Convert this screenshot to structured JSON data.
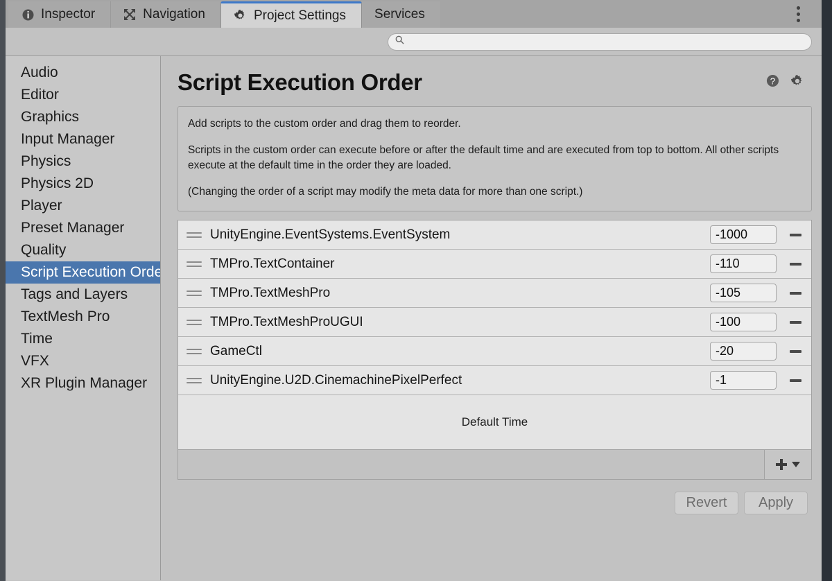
{
  "window": {
    "tabs": [
      {
        "label": "Inspector",
        "icon": "info-icon",
        "active": false
      },
      {
        "label": "Navigation",
        "icon": "move-arrows-icon",
        "active": false
      },
      {
        "label": "Project Settings",
        "icon": "gear-icon",
        "active": true
      },
      {
        "label": "Services",
        "icon": "none",
        "active": false
      }
    ],
    "menu_icon": "kebab-menu-icon",
    "accent_color": "#3d78c8"
  },
  "search": {
    "value": "",
    "placeholder": "",
    "icon": "search-icon"
  },
  "sidebar": {
    "items": [
      {
        "label": "Audio",
        "selected": false
      },
      {
        "label": "Editor",
        "selected": false
      },
      {
        "label": "Graphics",
        "selected": false
      },
      {
        "label": "Input Manager",
        "selected": false
      },
      {
        "label": "Physics",
        "selected": false
      },
      {
        "label": "Physics 2D",
        "selected": false
      },
      {
        "label": "Player",
        "selected": false
      },
      {
        "label": "Preset Manager",
        "selected": false
      },
      {
        "label": "Quality",
        "selected": false
      },
      {
        "label": "Script Execution Order",
        "selected": true
      },
      {
        "label": "Tags and Layers",
        "selected": false
      },
      {
        "label": "TextMesh Pro",
        "selected": false
      },
      {
        "label": "Time",
        "selected": false
      },
      {
        "label": "VFX",
        "selected": false
      },
      {
        "label": "XR Plugin Manager",
        "selected": false
      }
    ],
    "selected_color": "#4a76ad"
  },
  "page": {
    "title": "Script Execution Order",
    "help_icon": "help-icon",
    "settings_icon": "gear-icon",
    "help_text": [
      "Add scripts to the custom order and drag them to reorder.",
      "Scripts in the custom order can execute before or after the default time and are executed from top to bottom. All other scripts execute at the default time in the order they are loaded.",
      "(Changing the order of a script may modify the meta data for more than one script.)"
    ]
  },
  "script_order": {
    "rows": [
      {
        "name": "UnityEngine.EventSystems.EventSystem",
        "order": "-1000"
      },
      {
        "name": "TMPro.TextContainer",
        "order": "-110"
      },
      {
        "name": "TMPro.TextMeshPro",
        "order": "-105"
      },
      {
        "name": "TMPro.TextMeshProUGUI",
        "order": "-100"
      },
      {
        "name": "GameCtl",
        "order": "-20"
      },
      {
        "name": "UnityEngine.U2D.CinemachinePixelPerfect",
        "order": "-1"
      }
    ],
    "default_time_label": "Default Time",
    "add_icon": "plus-icon",
    "add_dropdown_icon": "caret-down-icon",
    "remove_icon": "minus-icon",
    "drag_handle_icon": "drag-handle-icon"
  },
  "footer": {
    "revert_label": "Revert",
    "apply_label": "Apply"
  }
}
